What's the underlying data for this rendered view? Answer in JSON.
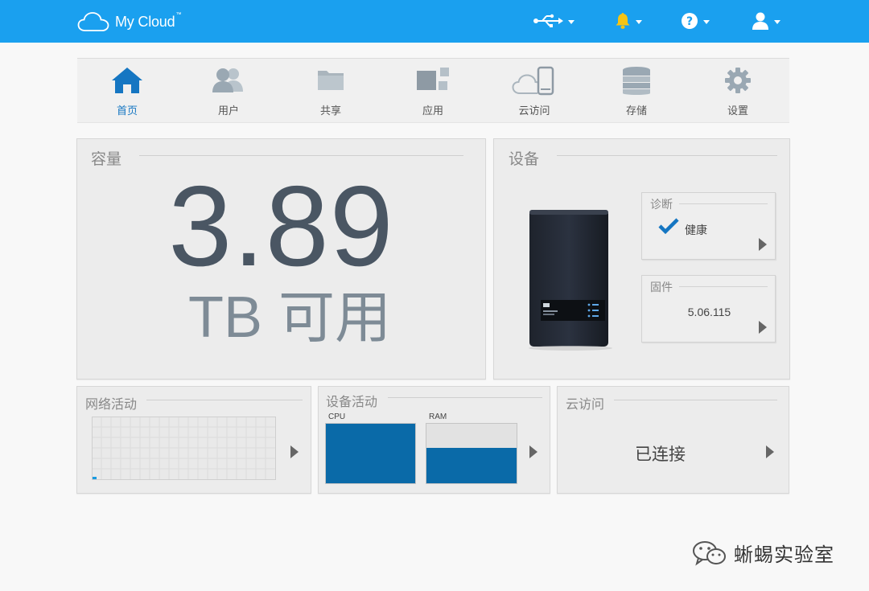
{
  "brand": {
    "name": "My Cloud",
    "tm": "™"
  },
  "topbar": {
    "icons": [
      "usb-icon",
      "bell-icon",
      "help-icon",
      "user-icon"
    ],
    "colors": {
      "bar": "#1aa0ef",
      "bell": "#f6c414"
    }
  },
  "nav": {
    "items": [
      {
        "label": "首页",
        "icon": "home-icon",
        "active": true
      },
      {
        "label": "用户",
        "icon": "users-icon"
      },
      {
        "label": "共享",
        "icon": "shares-icon"
      },
      {
        "label": "应用",
        "icon": "apps-icon"
      },
      {
        "label": "云访问",
        "icon": "cloud-access-icon"
      },
      {
        "label": "存储",
        "icon": "storage-icon"
      },
      {
        "label": "设置",
        "icon": "settings-icon"
      }
    ],
    "active_color": "#1576c2"
  },
  "capacity": {
    "title": "容量",
    "value": "3.89",
    "unit": "TB",
    "unit_label": "可用"
  },
  "device": {
    "title": "设备",
    "diagnostics": {
      "title": "诊断",
      "status": "健康"
    },
    "firmware": {
      "title": "固件",
      "version": "5.06.115"
    }
  },
  "network": {
    "title": "网络活动"
  },
  "device_activity": {
    "title": "设备活动",
    "cpu": {
      "label": "CPU",
      "usage": 1.0
    },
    "ram": {
      "label": "RAM",
      "usage": 0.6
    }
  },
  "cloud": {
    "title": "云访问",
    "status": "已连接"
  },
  "watermark": {
    "text": "蜥蜴实验室"
  }
}
